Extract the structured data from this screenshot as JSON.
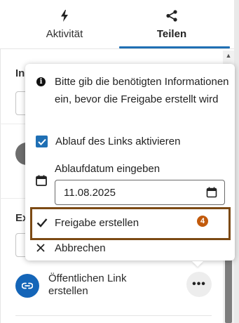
{
  "tabs": {
    "activity": {
      "label": "Aktivität",
      "icon": "lightning-icon"
    },
    "share": {
      "label": "Teilen",
      "icon": "share-icon",
      "active": true
    }
  },
  "popover": {
    "info_text": "Bitte gib die benötigten Informationen ein, bevor die Freigabe erstellt wird",
    "expire_checkbox": {
      "label": "Ablauf des Links aktivieren",
      "checked": true
    },
    "date": {
      "label": "Ablaufdatum eingeben",
      "value": "11.08.2025"
    },
    "create": {
      "label": "Freigabe erstellen",
      "step_number": "4"
    },
    "cancel": {
      "label": "Abbrechen"
    }
  },
  "background": {
    "section_1_initial": "In",
    "section_2_initial": "Ex"
  },
  "public_link": {
    "title": "Öffentlichen Link erstellen",
    "more_label": "•••"
  },
  "colors": {
    "accent": "#1f6fb4",
    "highlight_border": "#7c4a14",
    "step_badge": "#c25a0c",
    "link_avatar": "#1465b8"
  }
}
